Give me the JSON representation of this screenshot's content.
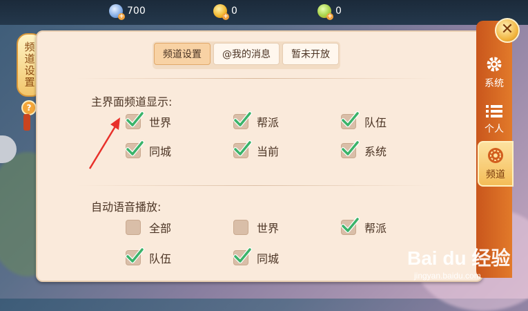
{
  "currency": [
    {
      "icon": "blue-gem-icon",
      "value": "700"
    },
    {
      "icon": "gold-coin-icon",
      "value": "0"
    },
    {
      "icon": "green-coin-icon",
      "value": "0"
    }
  ],
  "left_tag": {
    "label": "频道设置",
    "help": "?"
  },
  "sub_tabs": [
    {
      "label": "频道设置",
      "active": true
    },
    {
      "label": "@我的消息",
      "active": false
    },
    {
      "label": "暂未开放",
      "active": false
    }
  ],
  "channel_display": {
    "title": "主界面频道显示:",
    "options": [
      {
        "label": "世界",
        "checked": true
      },
      {
        "label": "帮派",
        "checked": true
      },
      {
        "label": "队伍",
        "checked": true
      },
      {
        "label": "同城",
        "checked": true
      },
      {
        "label": "当前",
        "checked": true
      },
      {
        "label": "系统",
        "checked": true
      }
    ]
  },
  "auto_voice": {
    "title": "自动语音播放:",
    "options": [
      {
        "label": "全部",
        "checked": false
      },
      {
        "label": "世界",
        "checked": false
      },
      {
        "label": "帮派",
        "checked": true
      },
      {
        "label": "队伍",
        "checked": true
      },
      {
        "label": "同城",
        "checked": true
      }
    ]
  },
  "side_tabs": [
    {
      "label": "系统",
      "icon": "gear-icon",
      "active": false
    },
    {
      "label": "个人",
      "icon": "list-icon",
      "active": false
    },
    {
      "label": "频道",
      "icon": "aperture-icon",
      "active": true
    }
  ],
  "close_label": "✕",
  "watermark": {
    "logo": "Bai du 经验",
    "url": "jingyan.baidu.com"
  },
  "colors": {
    "accent": "#e27a2a",
    "panel": "#faeadb",
    "check": "#3bb36a"
  }
}
